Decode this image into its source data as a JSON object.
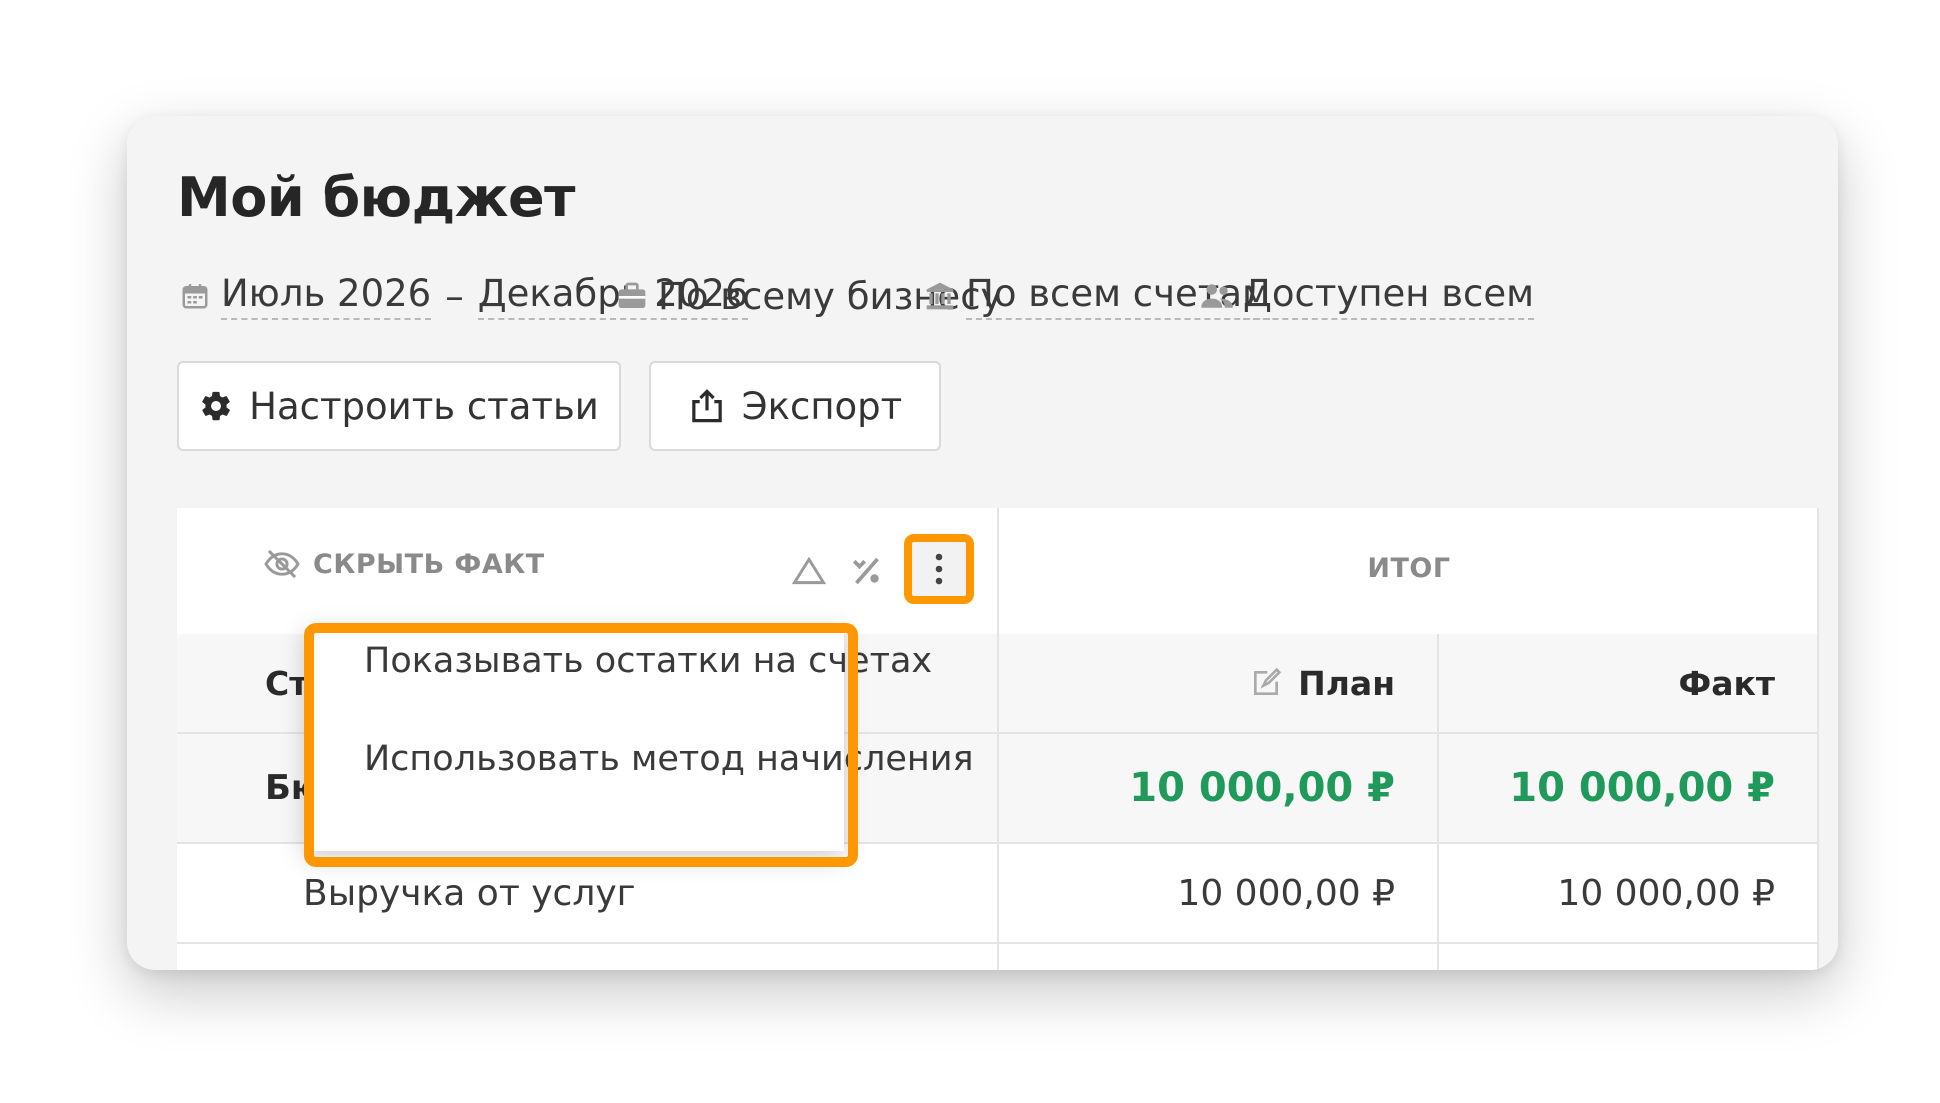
{
  "page": {
    "title": "Мой бюджет"
  },
  "filters": {
    "period_start": "Июль 2026",
    "period_separator": "–",
    "period_end": "Декабрь 2026",
    "business": "По всему бизнесу",
    "accounts": "По всем счетам",
    "access": "Доступен всем"
  },
  "toolbar": {
    "configure_label": "Настроить статьи",
    "export_label": "Экспорт"
  },
  "table": {
    "hide_fact_label": "СКРЫТЬ ФАКТ",
    "total_header": "ИТОГ",
    "col_article": "Статья",
    "col_plan": "План",
    "col_fact": "Факт",
    "group_row": {
      "label": "Бюджет",
      "plan": "10 000,00 ₽",
      "fact": "10 000,00 ₽"
    },
    "item_row": {
      "label": "Выручка от услуг",
      "plan": "10 000,00 ₽",
      "fact": "10 000,00 ₽"
    }
  },
  "menu": {
    "items": [
      "Показывать остатки на счетах",
      "Использовать метод начисления"
    ]
  },
  "colors": {
    "accent_highlight": "#ff9800",
    "positive": "#1f9a5a"
  },
  "icons": [
    "calendar-icon",
    "briefcase-icon",
    "bank-icon",
    "users-icon",
    "gear-icon",
    "export-icon",
    "eye-off-icon",
    "delta-icon",
    "percent-icon",
    "more-vertical-icon",
    "edit-icon"
  ]
}
